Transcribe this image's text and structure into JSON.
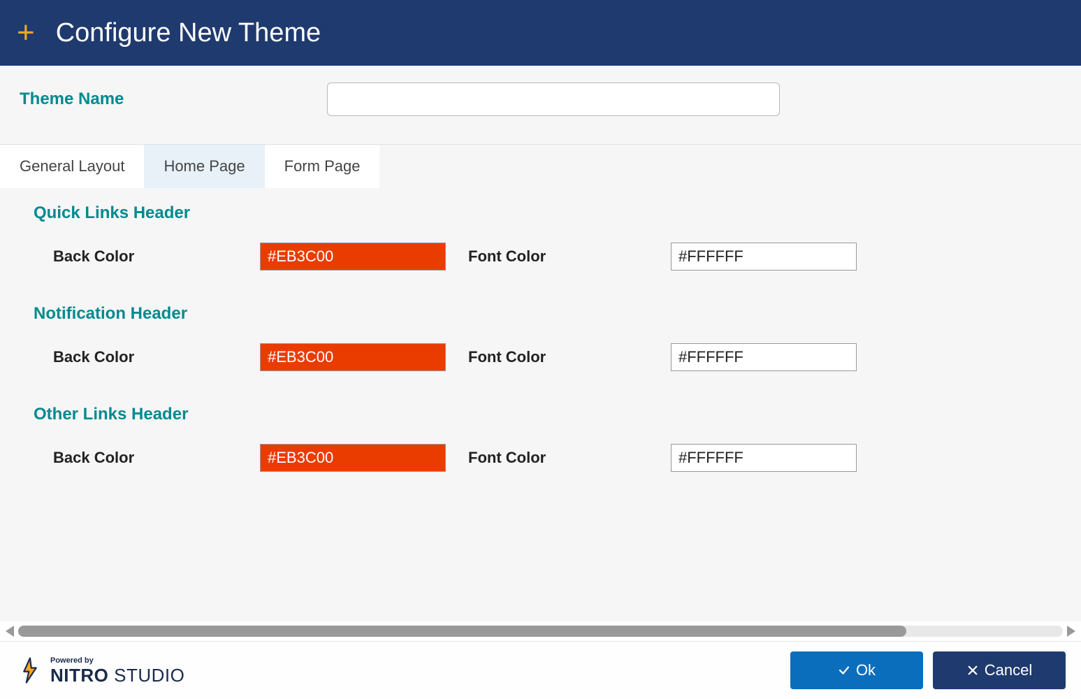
{
  "header": {
    "title": "Configure New Theme"
  },
  "themeName": {
    "label": "Theme Name",
    "value": ""
  },
  "tabs": [
    {
      "label": "General Layout",
      "active": false
    },
    {
      "label": "Home Page",
      "active": true
    },
    {
      "label": "Form Page",
      "active": false
    }
  ],
  "sections": [
    {
      "title": "Quick Links Header",
      "backColor": {
        "label": "Back Color",
        "value": "#EB3C00"
      },
      "fontColor": {
        "label": "Font Color",
        "value": "#FFFFFF"
      }
    },
    {
      "title": "Notification Header",
      "backColor": {
        "label": "Back Color",
        "value": "#EB3C00"
      },
      "fontColor": {
        "label": "Font Color",
        "value": "#FFFFFF"
      }
    },
    {
      "title": "Other Links Header",
      "backColor": {
        "label": "Back Color",
        "value": "#EB3C00"
      },
      "fontColor": {
        "label": "Font Color",
        "value": "#FFFFFF"
      }
    }
  ],
  "footer": {
    "logo": {
      "poweredBy": "Powered by",
      "brand1": "NITRO",
      "brand2": " STUDIO"
    },
    "ok": "Ok",
    "cancel": "Cancel"
  }
}
